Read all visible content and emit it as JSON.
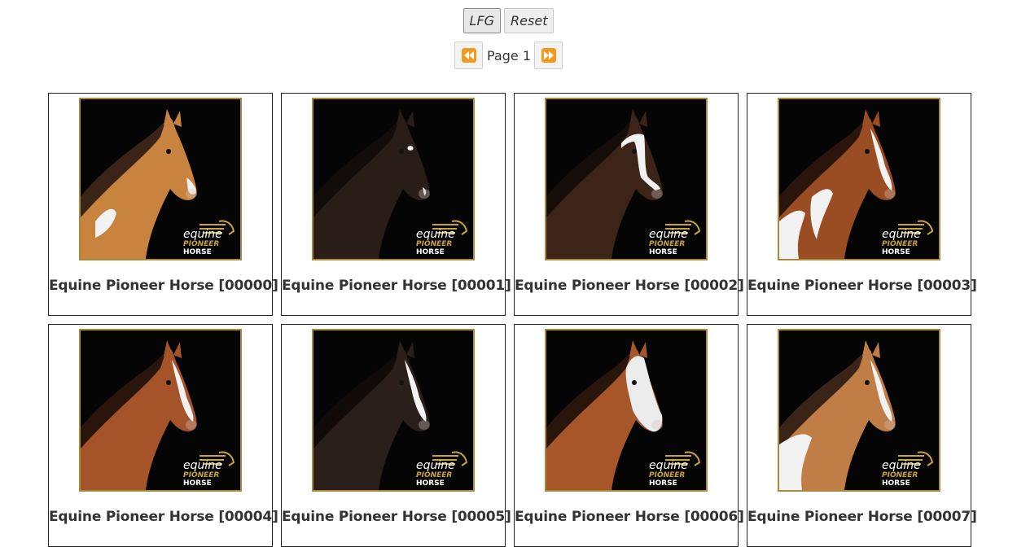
{
  "toolbar": {
    "lfg_label": "LFG",
    "reset_label": "Reset"
  },
  "pager": {
    "prev_icon": "rewind-icon",
    "next_icon": "fast-forward-icon",
    "page_label": "Page 1"
  },
  "logo": {
    "line1": "equine",
    "line2": "PIONEER",
    "line3": "HORSE"
  },
  "colors": {
    "accent_orange": "#f39a1e",
    "frame_gold": "#a88a3a",
    "logo_gold": "#c9a23a"
  },
  "items": [
    {
      "title": "Equine Pioneer Horse [00000]",
      "coat": "#c8833f",
      "mane": "#3a2418",
      "marking": "patch-neck"
    },
    {
      "title": "Equine Pioneer Horse [00001]",
      "coat": "#2a1d18",
      "mane": "#120c0a",
      "marking": "star"
    },
    {
      "title": "Equine Pioneer Horse [00002]",
      "coat": "#3d2418",
      "mane": "#150d09",
      "marking": "bridle"
    },
    {
      "title": "Equine Pioneer Horse [00003]",
      "coat": "#9a4c22",
      "mane": "#2a150c",
      "marking": "pinto"
    },
    {
      "title": "Equine Pioneer Horse [00004]",
      "coat": "#a5542a",
      "mane": "#2a150c",
      "marking": "blaze"
    },
    {
      "title": "Equine Pioneer Horse [00005]",
      "coat": "#2a1f1a",
      "mane": "#100b09",
      "marking": "blaze"
    },
    {
      "title": "Equine Pioneer Horse [00006]",
      "coat": "#a65628",
      "mane": "#2a150c",
      "marking": "white-face"
    },
    {
      "title": "Equine Pioneer Horse [00007]",
      "coat": "#c07d45",
      "mane": "#3a2418",
      "marking": "pinto-light"
    }
  ]
}
